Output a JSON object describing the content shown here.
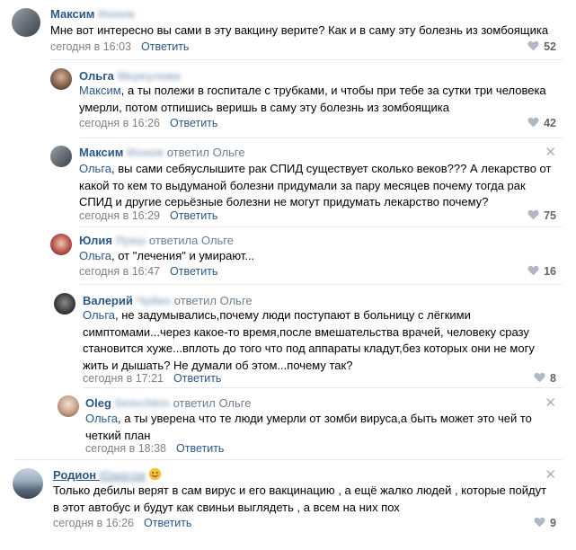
{
  "comments": [
    {
      "first": "Максим",
      "last": "Ионов",
      "replied_to": "",
      "mention": "",
      "text": "Мне вот интересно вы сами в эту вакцину верите? Как и в саму эту болезнь из зомбоящика",
      "time": "сегодня в 16:03",
      "reply_label": "Ответить",
      "likes": "52"
    },
    {
      "first": "Ольга",
      "last": "Меркулова",
      "replied_to": "",
      "mention": "Максим",
      "text": ", а ты полежи в госпитале с трубками, и чтобы при тебе за сутки три человека\nумерли, потом отпишись веришь в саму эту болезнь из зомбоящика",
      "time": "сегодня в 16:26",
      "reply_label": "Ответить",
      "likes": "42"
    },
    {
      "first": "Максим",
      "last": "Ионов",
      "replied_to": "ответил Ольге",
      "mention": "Ольга",
      "text": ", вы сами себяуслышите рак СПИД существует сколько веков??? А лекарство от\nкакой то кем то выдуманой болезни придумали за пару месяцев почему тогда рак\nСПИД и другие серьёзные болезни не могут придумать лекарство почему?",
      "time": "сегодня в 16:29",
      "reply_label": "Ответить",
      "likes": "75"
    },
    {
      "first": "Юлия",
      "last": "Лукш",
      "replied_to": "ответила Ольге",
      "mention": "Ольга",
      "text": ", от \"лечения\" и умирают...",
      "time": "сегодня в 16:47",
      "reply_label": "Ответить",
      "likes": "16"
    },
    {
      "first": "Валерий",
      "last": "Чуйко",
      "replied_to": "ответил Ольге",
      "mention": "Ольга",
      "text": ", не задумывались,почему люди поступают в больницу с лёгкими\nсимптомами...через какое-то время,после вмешательства врачей, человеку сразу\nстановится хуже...вплоть до того что под аппараты кладут,без которых они не могу\nжить и дышать? Не думали об этом...почему так?",
      "time": "сегодня в 17:21",
      "reply_label": "Ответить",
      "likes": "8"
    },
    {
      "first": "Oleg",
      "last": "Semchkin",
      "replied_to": "ответил Ольге",
      "mention": "Ольга",
      "text": ", а ты уверена что те люди умерли от зомби вируса,а быть может это чей то\nчеткий план",
      "time": "сегодня в 18:38",
      "reply_label": "Ответить",
      "likes": ""
    },
    {
      "first": "Родион",
      "last": "Юмагов",
      "replied_to": "",
      "mention": "",
      "text": "Только дебилы верят в сам вирус и его вакцинацию , а ещё жалко людей , которые пойдут\nв этот автобус и будут как свиньи выглядеть , а всем на них пох",
      "time": "сегодня в 16:26",
      "reply_label": "Ответить",
      "likes": "9"
    }
  ],
  "colors": {
    "link": "#2a5885",
    "meta": "#828282",
    "likes": "#656565",
    "heart": "#b0b9c3",
    "separator": "#e7e8ec"
  },
  "icons": {
    "like": "heart-icon",
    "close": "close-icon",
    "emoji": "smiling-face-emoji"
  }
}
